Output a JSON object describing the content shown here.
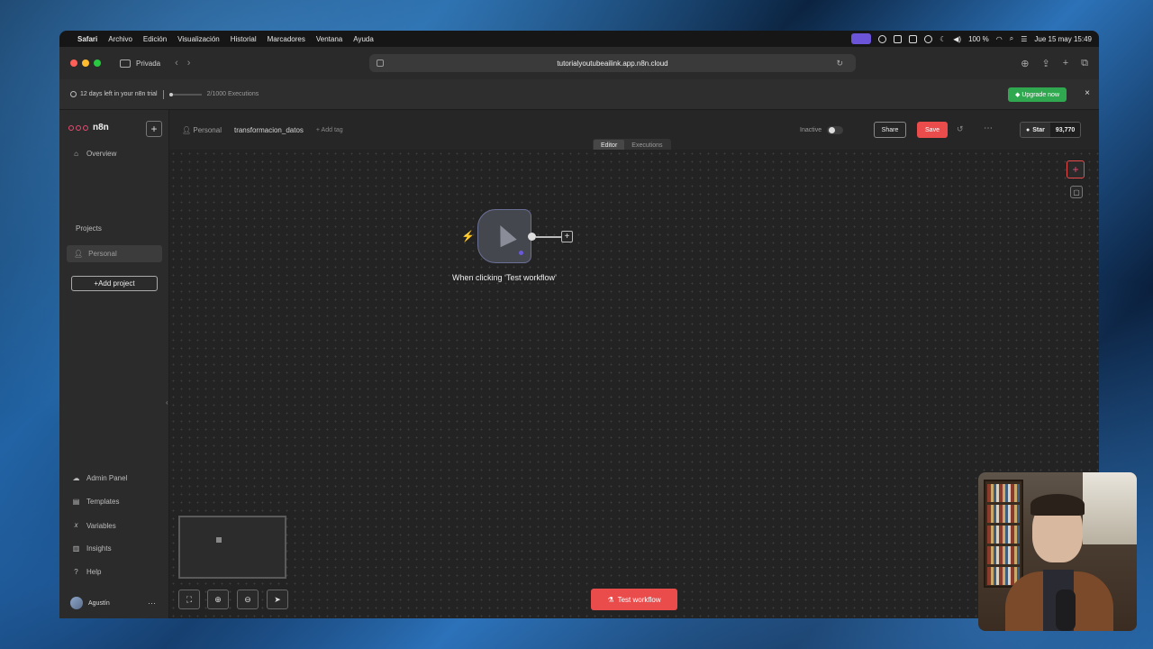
{
  "menubar": {
    "apple": "",
    "items": [
      "Safari",
      "Archivo",
      "Edición",
      "Visualización",
      "Historial",
      "Marcadores",
      "Ventana",
      "Ayuda"
    ],
    "battery": "100 %",
    "datetime": "Jue 15 may 15:49"
  },
  "browser": {
    "mode_label": "Privada",
    "url": "tutorialyoutubeailink.app.n8n.cloud"
  },
  "trial": {
    "days_left": "12 days left in your n8n trial",
    "executions": "2/1000 Executions",
    "executions_fraction": 0.002,
    "upgrade_label": "Upgrade now",
    "close": "×"
  },
  "sidebar": {
    "logo_text": "n8n",
    "new_label": "+",
    "overview": "Overview",
    "projects_label": "Projects",
    "personal": "Personal",
    "add_project": "+Add project",
    "bottom_items": [
      {
        "label": "Admin Panel",
        "icon": "cloud-icon"
      },
      {
        "label": "Templates",
        "icon": "templates-icon"
      },
      {
        "label": "Variables",
        "icon": "variables-icon"
      },
      {
        "label": "Insights",
        "icon": "insights-icon"
      },
      {
        "label": "Help",
        "icon": "help-icon"
      }
    ],
    "user_name": "Agustín",
    "user_more": "⋯"
  },
  "header": {
    "project": "Personal",
    "workflow_name": "transformacion_datos",
    "add_tag": "+ Add tag",
    "status": "Inactive",
    "share_label": "Share",
    "save_label": "Save",
    "more": "⋯",
    "github_star": "Star",
    "github_count": "93,770",
    "tabs": [
      "Editor",
      "Executions"
    ]
  },
  "canvas": {
    "node_label": "When clicking ‘Test workflow’",
    "test_button": "Test workflow",
    "add_label": "+"
  },
  "colors": {
    "accent": "#ea4b4b",
    "upgrade_green": "#2fa84f",
    "node_border": "#6b7096",
    "background": "#262626"
  }
}
